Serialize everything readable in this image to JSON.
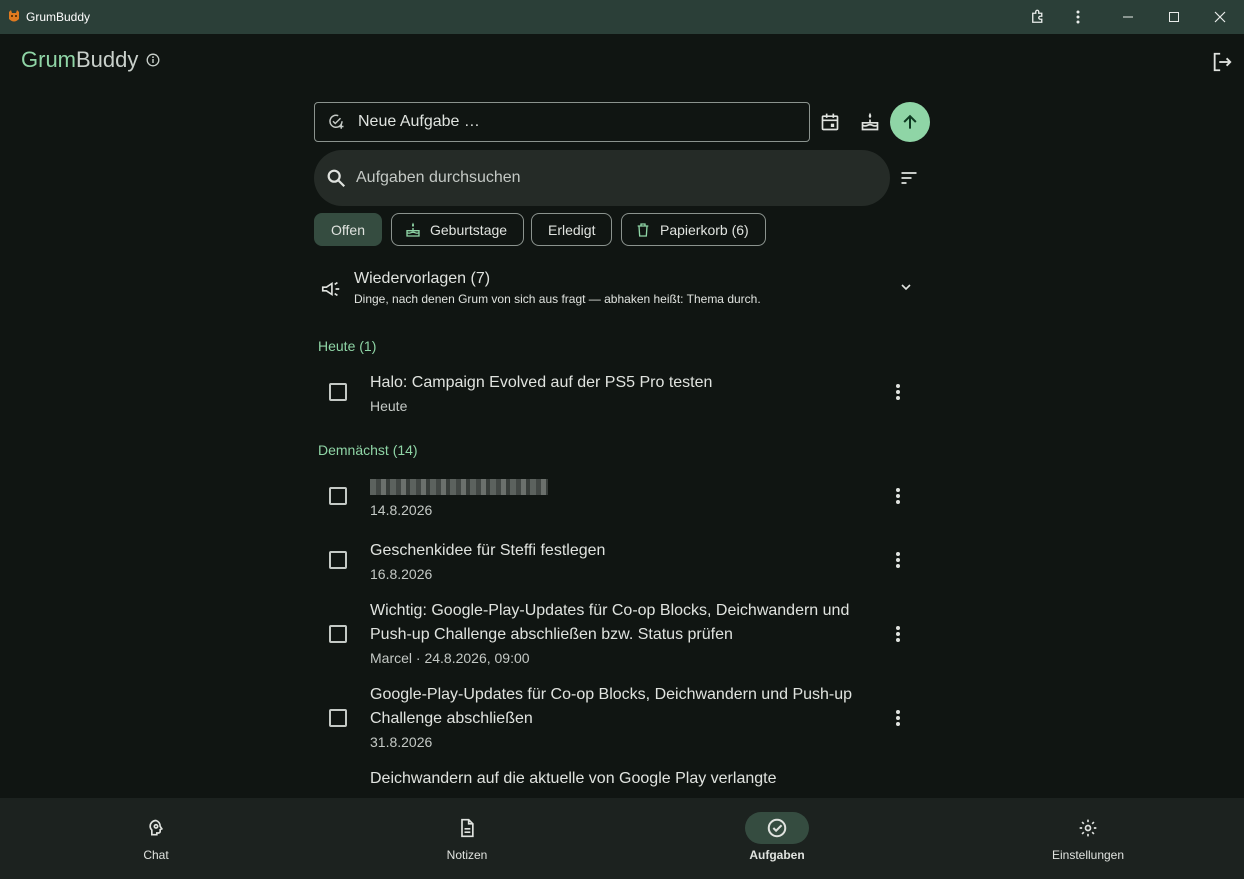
{
  "window": {
    "title": "GrumBuddy",
    "icons": [
      "app-icon",
      "extension-icon",
      "more-vert-icon",
      "minimize-icon",
      "maximize-icon",
      "close-icon"
    ]
  },
  "header": {
    "title_part1": "Grum",
    "title_part2": "Buddy",
    "info_icon": "info-icon",
    "logout_icon": "logout-icon"
  },
  "task_input": {
    "placeholder": "Neue Aufgabe …",
    "icons": [
      "add-task-icon",
      "calendar-icon",
      "cake-icon",
      "arrow-up-icon"
    ]
  },
  "search": {
    "placeholder": "Aufgaben durchsuchen",
    "icons": [
      "search-icon",
      "sort-icon"
    ]
  },
  "filters": {
    "open": "Offen",
    "birthdays": "Geburtstage",
    "done": "Erledigt",
    "trash": "Papierkorb (6)"
  },
  "reminders": {
    "title": "Wiedervorlagen (7)",
    "subtitle": "Dinge, nach denen Grum von sich aus fragt — abhaken heißt: Thema durch."
  },
  "sections": {
    "today": "Heute (1)",
    "upcoming": "Demnächst (14)"
  },
  "tasks_today": [
    {
      "title": "Halo: Campaign Evolved auf der PS5 Pro testen",
      "meta": "Heute"
    }
  ],
  "tasks_upcoming": [
    {
      "title": "",
      "meta": "14.8.2026"
    },
    {
      "title": "Geschenkidee für Steffi festlegen",
      "meta": "16.8.2026"
    },
    {
      "title": "Wichtig: Google-Play-Updates für Co-op Blocks, Deichwandern und Push-up Challenge abschließen bzw. Status prüfen",
      "meta": "Marcel · 24.8.2026, 09:00"
    },
    {
      "title": "Google-Play-Updates für Co-op Blocks, Deichwandern und Push-up Challenge abschließen",
      "meta": "31.8.2026"
    },
    {
      "title": "Deichwandern auf die aktuelle von Google Play verlangte",
      "meta": ""
    }
  ],
  "bottom_nav": {
    "chat": "Chat",
    "notes": "Notizen",
    "tasks": "Aufgaben",
    "settings": "Einstellungen"
  },
  "colors": {
    "accent": "#8fd5a6",
    "background": "#101512",
    "titlebar": "#2b3f38",
    "nav_background": "#1c221f",
    "selected": "#354c40"
  }
}
